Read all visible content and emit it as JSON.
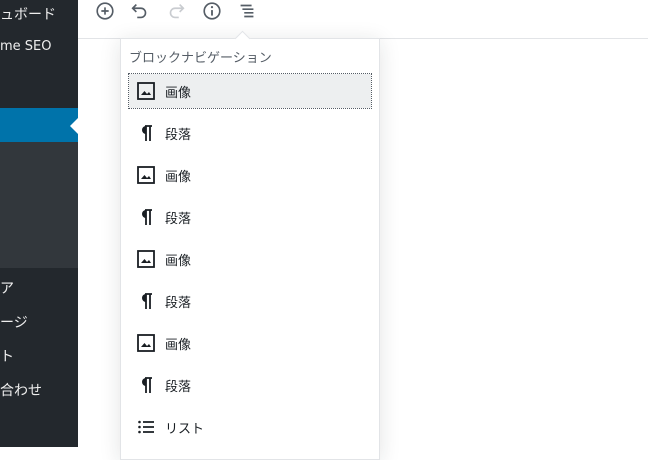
{
  "sidebar": {
    "items": [
      {
        "label": "ュボード"
      },
      {
        "label": "me SEO"
      },
      {
        "label": "ア"
      },
      {
        "label": "ージ"
      },
      {
        "label": "ト"
      },
      {
        "label": "合わせ"
      }
    ]
  },
  "toolbar": {
    "buttons": [
      {
        "icon": "plus-circle-icon"
      },
      {
        "icon": "undo-icon"
      },
      {
        "icon": "redo-icon"
      },
      {
        "icon": "info-icon"
      },
      {
        "icon": "block-navigation-icon"
      }
    ]
  },
  "block_navigation": {
    "title": "ブロックナビゲーション",
    "items": [
      {
        "icon": "image-icon",
        "label": "画像",
        "selected": true
      },
      {
        "icon": "paragraph-icon",
        "label": "段落"
      },
      {
        "icon": "image-icon",
        "label": "画像"
      },
      {
        "icon": "paragraph-icon",
        "label": "段落"
      },
      {
        "icon": "image-icon",
        "label": "画像"
      },
      {
        "icon": "paragraph-icon",
        "label": "段落"
      },
      {
        "icon": "image-icon",
        "label": "画像"
      },
      {
        "icon": "paragraph-icon",
        "label": "段落"
      },
      {
        "icon": "list-icon",
        "label": "リスト"
      }
    ]
  },
  "colors": {
    "sidebar_bg": "#23282d",
    "sidebar_submenu_bg": "#32373c",
    "sidebar_active": "#0073aa",
    "selected_item_bg": "#edeff0"
  }
}
